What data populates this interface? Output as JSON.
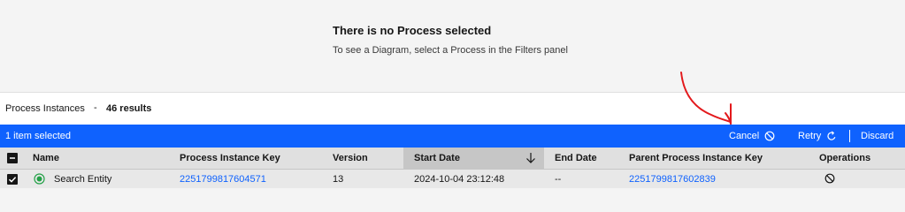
{
  "diagram": {
    "empty_title": "There is no Process selected",
    "empty_description": "To see a Diagram, select a Process in the Filters panel"
  },
  "panel": {
    "title": "Process Instances",
    "separator": "-",
    "results": "46 results"
  },
  "selection_bar": {
    "selected_text": "1 item selected",
    "cancel_label": "Cancel",
    "retry_label": "Retry",
    "discard_label": "Discard",
    "color": "#0f62fe"
  },
  "table": {
    "columns": [
      "Name",
      "Process Instance Key",
      "Version",
      "Start Date",
      "End Date",
      "Parent Process Instance Key",
      "Operations"
    ],
    "sorted_column": "Start Date",
    "sort_direction": "descending",
    "rows": [
      {
        "selected": true,
        "state_icon": "active-state-icon",
        "name": "Search Entity",
        "process_instance_key": "2251799817604571",
        "version": "13",
        "start_date": "2024-10-04 23:12:48",
        "end_date": "--",
        "parent_process_instance_key": "2251799817602839",
        "operation_icon": "cancel-operation-icon"
      }
    ]
  },
  "annotation": {
    "type": "hand-drawn-arrow",
    "color": "#e3191c"
  }
}
